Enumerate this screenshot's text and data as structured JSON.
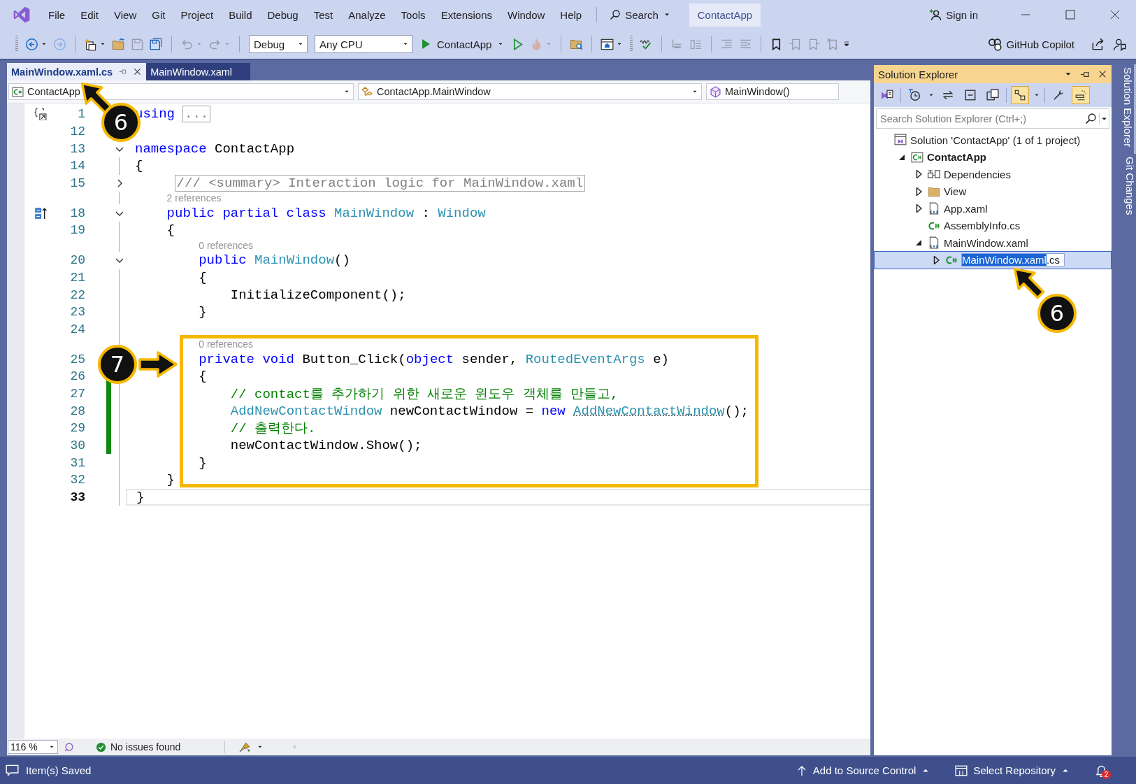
{
  "title_bar": {
    "menu": [
      "File",
      "Edit",
      "View",
      "Git",
      "Project",
      "Build",
      "Debug",
      "Test",
      "Analyze",
      "Tools",
      "Extensions",
      "Window",
      "Help"
    ],
    "search": "Search",
    "solution_name": "ContactApp",
    "sign_in": "Sign in"
  },
  "toolbar": {
    "items": [
      {
        "kind": "grip"
      },
      {
        "kind": "icon",
        "disabled": false,
        "menu": true
      },
      {
        "kind": "icon",
        "disabled": true,
        "menu": false
      },
      {
        "kind": "separator"
      },
      {
        "kind": "icon",
        "disabled": false,
        "menu": true
      },
      {
        "kind": "icon",
        "disabled": false,
        "menu": false
      },
      {
        "kind": "icon",
        "disabled": true,
        "menu": false
      },
      {
        "kind": "icon",
        "disabled": false,
        "menu": false
      },
      {
        "kind": "separator"
      },
      {
        "kind": "icon",
        "disabled": true,
        "menu": true
      },
      {
        "kind": "icon",
        "disabled": true,
        "menu": true
      },
      {
        "kind": "separator"
      },
      {
        "kind": "dropdown",
        "value": "Debug"
      },
      {
        "kind": "dropdown",
        "value": "Any CPU"
      },
      {
        "kind": "run",
        "label": "ContactApp"
      },
      {
        "kind": "icon",
        "disabled": false,
        "menu": false
      },
      {
        "kind": "icon",
        "disabled": true,
        "menu": true
      },
      {
        "kind": "separator"
      },
      {
        "kind": "icon",
        "disabled": false,
        "menu": false
      },
      {
        "kind": "separator"
      },
      {
        "kind": "icon",
        "disabled": false,
        "menu": true
      },
      {
        "kind": "grip"
      },
      {
        "kind": "icon",
        "disabled": false,
        "menu": false
      },
      {
        "kind": "separator"
      },
      {
        "kind": "icon",
        "disabled": true,
        "menu": false
      },
      {
        "kind": "icon",
        "disabled": true,
        "menu": false
      },
      {
        "kind": "separator"
      },
      {
        "kind": "icon",
        "disabled": true,
        "menu": false
      },
      {
        "kind": "icon",
        "disabled": true,
        "menu": false
      },
      {
        "kind": "separator"
      },
      {
        "kind": "icon",
        "disabled": false,
        "menu": false
      },
      {
        "kind": "icon",
        "disabled": true,
        "menu": false
      },
      {
        "kind": "icon",
        "disabled": true,
        "menu": false
      },
      {
        "kind": "icon",
        "disabled": true,
        "menu": false
      },
      {
        "kind": "overflow"
      }
    ],
    "copilot": "GitHub Copilot"
  },
  "tabs": [
    {
      "label": "MainWindow.xaml.cs",
      "selected": true
    },
    {
      "label": "MainWindow.xaml",
      "selected": false
    }
  ],
  "navigation_bar": [
    "ContactApp",
    "ContactApp.MainWindow",
    "MainWindow()"
  ],
  "code": {
    "lines": [
      {
        "kind": "code",
        "number": "1",
        "changed": false,
        "current": false,
        "tokens": [
          {
            "kind": "keyword",
            "text": "using"
          },
          {
            "kind": "collapsed",
            "text": "..."
          }
        ]
      },
      {
        "kind": "code",
        "number": "12",
        "changed": false,
        "current": false
      },
      {
        "kind": "code",
        "number": "13",
        "fold_marker": {
          "expanded": true
        },
        "changed": false,
        "current": false,
        "tokens": [
          {
            "kind": "keyword",
            "text": "namespace"
          },
          {
            "kind": "plain",
            "text": " ContactApp"
          }
        ]
      },
      {
        "kind": "code",
        "number": "14",
        "changed": false,
        "current": false,
        "tokens": [
          {
            "kind": "plain",
            "text": "{"
          }
        ]
      },
      {
        "kind": "code",
        "number": "15",
        "fold_marker": {
          "expanded": false
        },
        "changed": false,
        "current": false,
        "tokens": [
          {
            "kind": "collapsed",
            "text": "    /// <summary> Interaction logic for MainWindow.xaml"
          }
        ]
      },
      {
        "kind": "lens",
        "text": "2 references"
      },
      {
        "kind": "code",
        "number": "18",
        "fold_marker": {
          "expanded": true
        },
        "changed": false,
        "current": false,
        "tokens": [
          {
            "kind": "keyword",
            "text": "    public partial class "
          },
          {
            "kind": "type",
            "text": "MainWindow"
          },
          {
            "kind": "plain",
            "text": " : "
          },
          {
            "kind": "type",
            "text": "Window"
          }
        ]
      },
      {
        "kind": "code",
        "number": "19",
        "changed": false,
        "current": false,
        "tokens": [
          {
            "kind": "plain",
            "text": "    {"
          }
        ]
      },
      {
        "kind": "lens",
        "text": "0 references"
      },
      {
        "kind": "code",
        "number": "20",
        "fold_marker": {
          "expanded": true
        },
        "changed": false,
        "current": false,
        "tokens": [
          {
            "kind": "keyword",
            "text": "        public "
          },
          {
            "kind": "type",
            "text": "MainWindow"
          },
          {
            "kind": "plain",
            "text": "()"
          }
        ]
      },
      {
        "kind": "code",
        "number": "21",
        "changed": false,
        "current": false,
        "tokens": [
          {
            "kind": "plain",
            "text": "        {"
          }
        ]
      },
      {
        "kind": "code",
        "number": "22",
        "changed": false,
        "current": false,
        "tokens": [
          {
            "kind": "plain",
            "text": "            InitializeComponent();"
          }
        ]
      },
      {
        "kind": "code",
        "number": "23",
        "changed": false,
        "current": false,
        "tokens": [
          {
            "kind": "plain",
            "text": "        }"
          }
        ]
      },
      {
        "kind": "code",
        "number": "24",
        "changed": false,
        "current": false
      },
      {
        "kind": "lens",
        "text": "0 references"
      },
      {
        "kind": "code",
        "number": "25",
        "changed": false,
        "current": false,
        "tokens": [
          {
            "kind": "keyword",
            "text": "        private void"
          },
          {
            "kind": "plain",
            "text": " Button_Click("
          },
          {
            "kind": "keyword",
            "text": "object"
          },
          {
            "kind": "plain",
            "text": " sender, "
          },
          {
            "kind": "type",
            "text": "RoutedEventArgs"
          },
          {
            "kind": "plain",
            "text": " e)"
          }
        ]
      },
      {
        "kind": "code",
        "number": "26",
        "changed": true,
        "current": false,
        "tokens": [
          {
            "kind": "plain",
            "text": "        {"
          }
        ]
      },
      {
        "kind": "code",
        "number": "27",
        "changed": true,
        "current": false,
        "tokens": [
          {
            "kind": "comment",
            "text": "            // contact를 추가하기 위한 새로운 윈도우 객체를 만들고,"
          }
        ]
      },
      {
        "kind": "code",
        "number": "28",
        "changed": true,
        "current": false,
        "tokens": [
          {
            "kind": "type",
            "text": "            AddNewContactWindow"
          },
          {
            "kind": "plain",
            "text": " newContactWindow = "
          },
          {
            "kind": "keyword",
            "text": "new "
          },
          {
            "kind": "hint",
            "text": "AddNewContactWindow"
          },
          {
            "kind": "plain",
            "text": "();"
          }
        ]
      },
      {
        "kind": "code",
        "number": "29",
        "changed": true,
        "current": false,
        "tokens": [
          {
            "kind": "comment",
            "text": "            // 출력한다."
          }
        ]
      },
      {
        "kind": "code",
        "number": "30",
        "changed": true,
        "current": false,
        "tokens": [
          {
            "kind": "plain",
            "text": "            newContactWindow.Show();"
          }
        ]
      },
      {
        "kind": "code",
        "number": "31",
        "changed": false,
        "current": false,
        "tokens": [
          {
            "kind": "plain",
            "text": "        }"
          }
        ]
      },
      {
        "kind": "code",
        "number": "32",
        "changed": false,
        "current": false,
        "tokens": [
          {
            "kind": "plain",
            "text": "    }"
          }
        ]
      },
      {
        "kind": "code",
        "number": "33",
        "changed": false,
        "current": true,
        "tokens": [
          {
            "kind": "plain",
            "text": "}"
          }
        ]
      }
    ]
  },
  "editor_status": {
    "zoom": "116 %",
    "issues": "No issues found"
  },
  "solution_explorer": {
    "title": "Solution Explorer",
    "tool_buttons": [
      {
        "kind": "icon",
        "on": false
      },
      {
        "kind": "separator"
      },
      {
        "kind": "icon",
        "on": false
      },
      {
        "kind": "icon",
        "on": false
      },
      {
        "kind": "icon",
        "on": false
      },
      {
        "kind": "icon",
        "on": false
      },
      {
        "kind": "separator"
      },
      {
        "kind": "icon",
        "on": true
      },
      {
        "kind": "separator"
      },
      {
        "kind": "icon",
        "on": false
      },
      {
        "kind": "icon",
        "on": true
      }
    ],
    "search": {
      "placeholder": "Search Solution Explorer (Ctrl+;)"
    },
    "tree": [
      {
        "kind": "solution",
        "label": "Solution 'ContactApp' (1 of 1 project)",
        "startup": false,
        "selected": false,
        "children": [
          {
            "kind": "project",
            "label": "ContactApp",
            "expander": {
              "expanded": true
            },
            "startup": true,
            "selected": false,
            "children": [
              {
                "kind": "dependencies",
                "label": "Dependencies",
                "expander": {
                  "expanded": false
                },
                "startup": false,
                "selected": false
              },
              {
                "kind": "folder",
                "label": "View",
                "expander": {
                  "expanded": false
                },
                "startup": false,
                "selected": false
              },
              {
                "kind": "xaml",
                "label": "App.xaml",
                "expander": {
                  "expanded": false
                },
                "startup": false,
                "selected": false
              },
              {
                "kind": "csharp",
                "label": "AssemblyInfo.cs",
                "startup": false,
                "selected": false
              },
              {
                "kind": "xaml",
                "label": "MainWindow.xaml",
                "expander": {
                  "expanded": true
                },
                "startup": false,
                "selected": false,
                "children": [
                  {
                    "kind": "csharp",
                    "rename_field": {
                      "selected_text": "MainWindow.xaml",
                      "text_after": ".cs"
                    },
                    "expander": {
                      "expanded": false
                    },
                    "startup": false,
                    "selected": true
                  }
                ]
              }
            ]
          }
        ]
      }
    ]
  },
  "side_tabs": [
    "Solution Explorer",
    "Git Changes"
  ],
  "status_bar": {
    "message": "Item(s) Saved",
    "source_control": "Add to Source Control",
    "repository": "Select Repository",
    "notifications": "2"
  },
  "annotations": {
    "callouts": [
      "6",
      "6",
      "7"
    ],
    "highlight_frame": true
  }
}
